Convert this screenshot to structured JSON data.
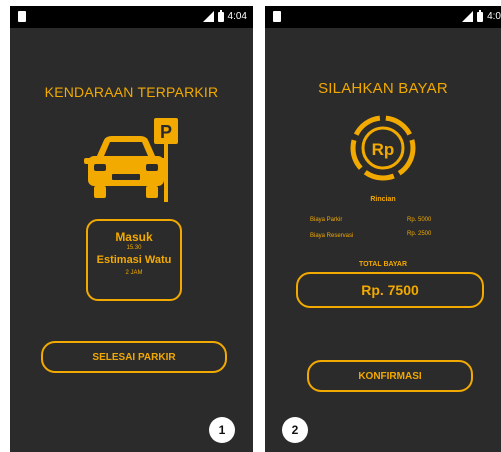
{
  "colors": {
    "accent": "#f2a900",
    "background": "#2b2b2b",
    "statusbar": "#000000"
  },
  "screen1": {
    "status_time": "4:04",
    "title": "KENDARAAN TERPARKIR",
    "icon": "car-parking-icon",
    "parking_sign": "P",
    "masuk_label": "Masuk",
    "masuk_time": "15.30",
    "estimasi_label": "Estimasi Watu",
    "estimasi_value": "2 JAM",
    "button_label": "SELESAI PARKIR",
    "badge": "1"
  },
  "screen2": {
    "status_time": "4:0",
    "title": "SILAHKAN BAYAR",
    "icon": "rupiah-coin-icon",
    "coin_text": "Rp",
    "rincian_label": "Rincian",
    "details": [
      {
        "label": "Biaya Parkir",
        "value": "Rp. 5000"
      },
      {
        "label": "Biaya Reservasi",
        "value": "Rp. 2500"
      }
    ],
    "total_label": "TOTAL BAYAR",
    "total_value": "Rp. 7500",
    "button_label": "KONFIRMASI",
    "badge": "2"
  }
}
